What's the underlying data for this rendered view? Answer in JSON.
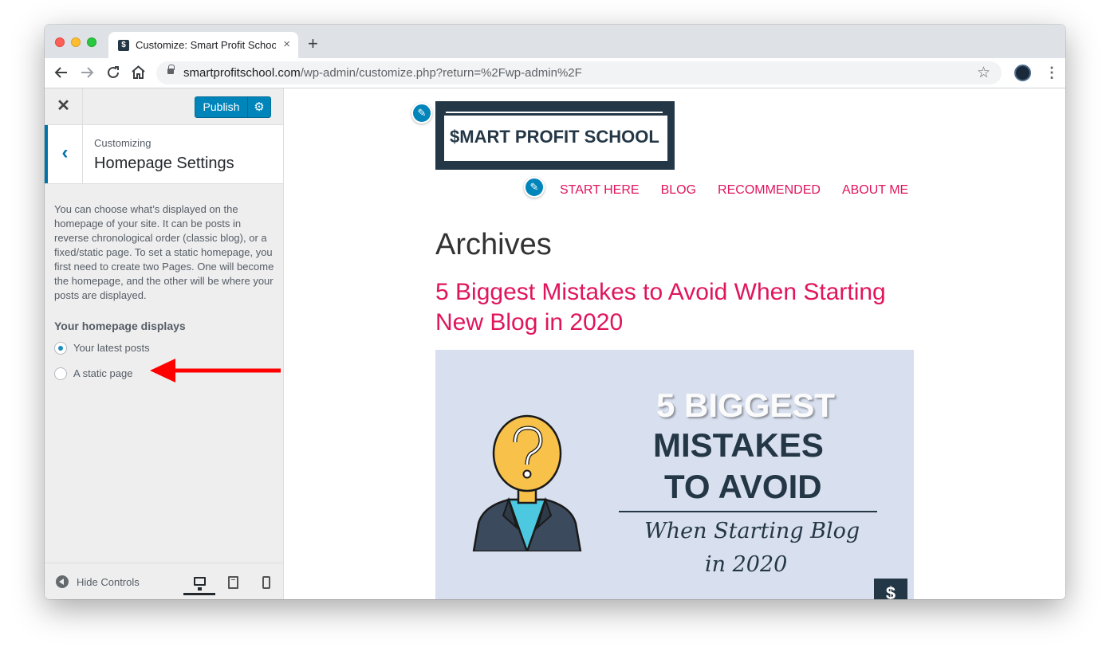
{
  "browser": {
    "tab_title": "Customize: Smart Profit School",
    "tab_favicon": "$",
    "tab_close": "×",
    "new_tab": "+",
    "url_domain": "smartprofitschool.com",
    "url_path": "/wp-admin/customize.php?return=%2Fwp-admin%2F",
    "icons": [
      "back-arrow-icon",
      "forward-arrow-icon",
      "reload-icon",
      "home-icon",
      "lock-icon",
      "star-icon",
      "profile-avatar",
      "more-menu-icon"
    ]
  },
  "sidebar": {
    "close": "✕",
    "publish_label": "Publish",
    "publish_gear": "⚙",
    "section_back": "‹",
    "eyebrow": "Customizing",
    "title": "Homepage Settings",
    "description": "You can choose what’s displayed on the homepage of your site. It can be posts in reverse chronological order (classic blog), or a fixed/static page. To set a static homepage, you first need to create two Pages. One will become the homepage, and the other will be where your posts are displayed.",
    "options_label": "Your homepage displays",
    "options": [
      {
        "label": "Your latest posts",
        "checked": true
      },
      {
        "label": "A static page",
        "checked": false
      }
    ],
    "annotation_arrow_color": "#ff0000",
    "footer": {
      "hide_controls": "Hide Controls",
      "devices": [
        "desktop",
        "tablet",
        "mobile"
      ],
      "active_device": "desktop"
    }
  },
  "preview": {
    "pencil": "✎",
    "logo": {
      "dollar": "$",
      "text": "MART PROFIT SCHOOL"
    },
    "nav": [
      "START HERE",
      "BLOG",
      "RECOMMENDED",
      "ABOUT ME"
    ],
    "page_title": "Archives",
    "post_title": "5 Biggest Mistakes to Avoid When Starting New Blog in 2020",
    "featured_image": {
      "line1": "5 BIGGEST",
      "line2": "MISTAKES",
      "line3": "TO AVOID",
      "sub1": "When Starting Blog",
      "sub2": "in 2020",
      "badge": "$"
    }
  },
  "colors": {
    "accent": "#0085ba",
    "link": "#e0155c",
    "brand_dark": "#243746",
    "image_bg": "#d8dfee"
  }
}
